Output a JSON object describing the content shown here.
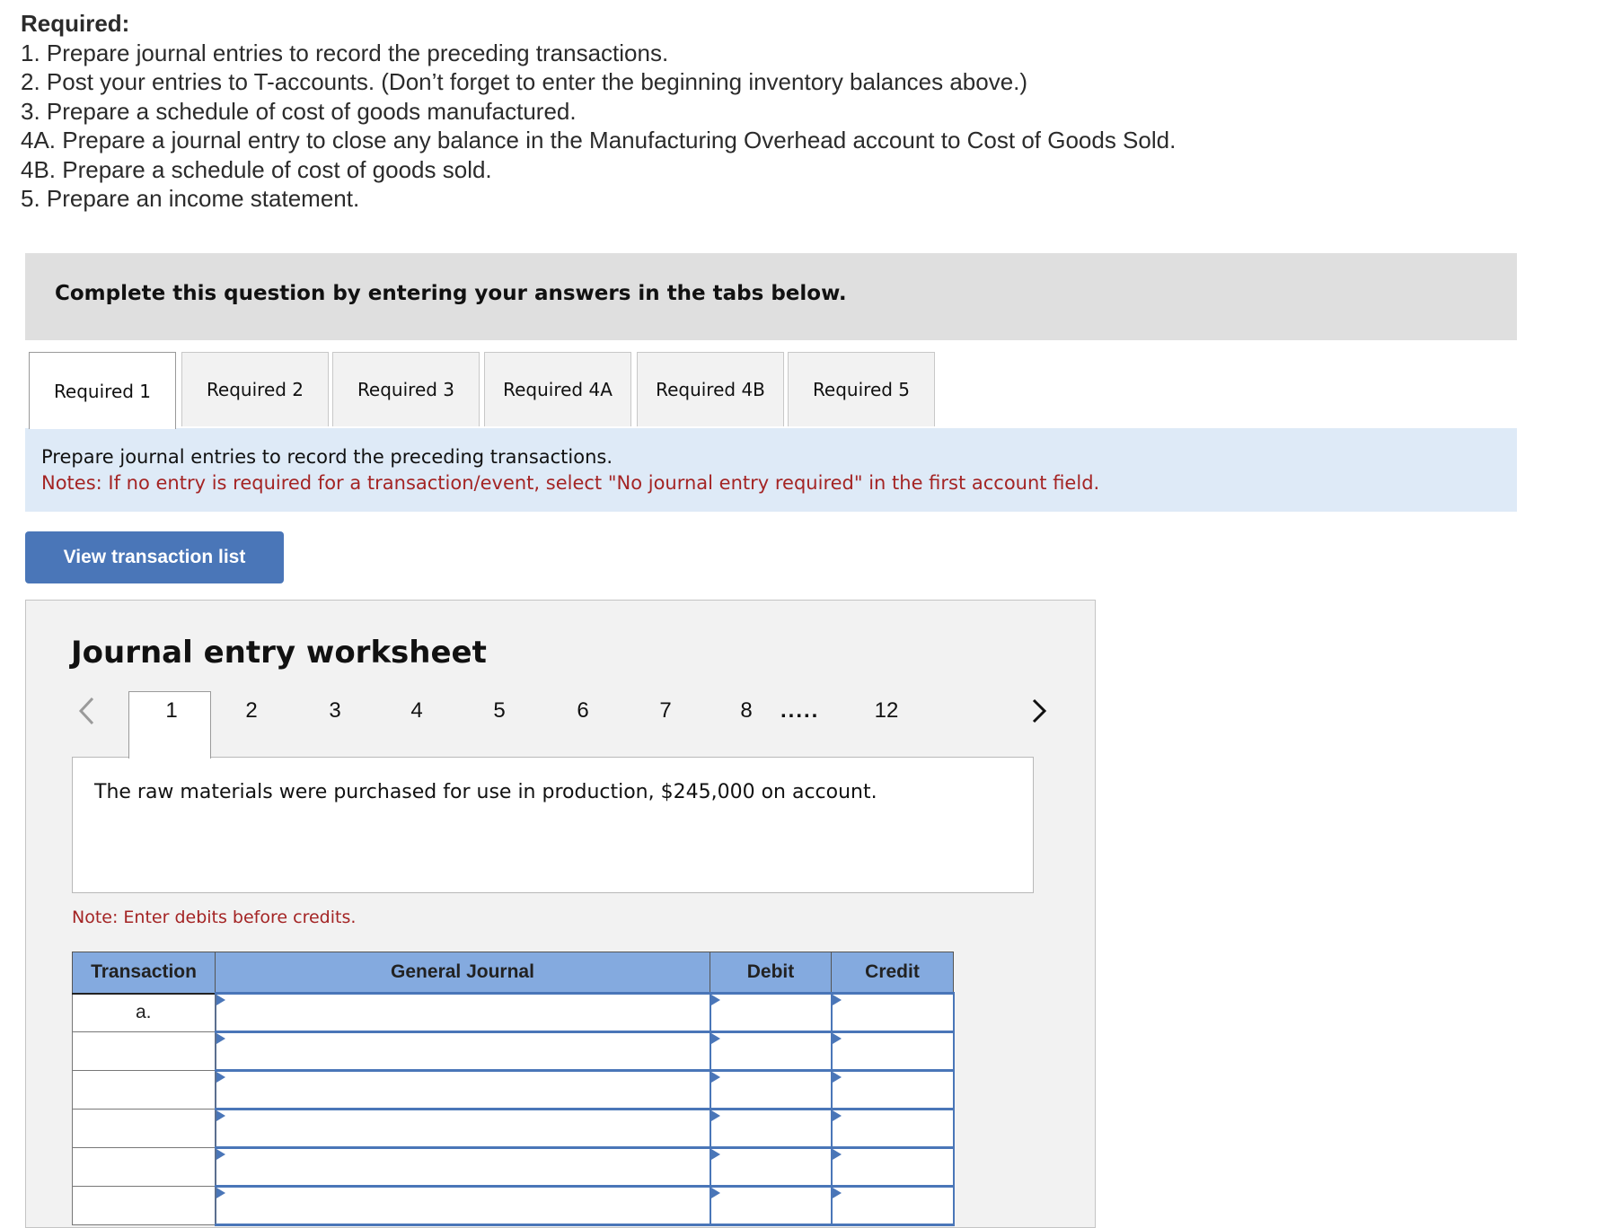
{
  "required": {
    "title": "Required:",
    "items": [
      "1. Prepare journal entries to record the preceding transactions.",
      "2. Post your entries to T-accounts. (Don’t forget to enter the beginning inventory balances above.)",
      "3. Prepare a schedule of cost of goods manufactured.",
      "4A. Prepare a journal entry to close any balance in the Manufacturing Overhead account to Cost of Goods Sold.",
      "4B. Prepare a schedule of cost of goods sold.",
      "5. Prepare an income statement."
    ]
  },
  "instructions": "Complete this question by entering your answers in the tabs below.",
  "tabs": [
    {
      "label": "Required 1",
      "active": true
    },
    {
      "label": "Required 2",
      "active": false
    },
    {
      "label": "Required 3",
      "active": false
    },
    {
      "label": "Required 4A",
      "active": false
    },
    {
      "label": "Required 4B",
      "active": false
    },
    {
      "label": "Required 5",
      "active": false
    }
  ],
  "panel": {
    "prompt": "Prepare journal entries to record the preceding transactions.",
    "note": "Notes: If no entry is required for a transaction/event, select \"No journal entry required\" in the first account field."
  },
  "view_button": "View transaction list",
  "worksheet": {
    "title": "Journal entry worksheet",
    "pages": [
      "1",
      "2",
      "3",
      "4",
      "5",
      "6",
      "7",
      "8",
      "12"
    ],
    "ellipsis": ".....",
    "active_page": "1",
    "prev_icon": "chevron-left-icon",
    "next_icon": "chevron-right-icon",
    "description": "The raw materials were purchased for use in production, $245,000 on account.",
    "debit_note": "Note: Enter debits before credits."
  },
  "table": {
    "headers": {
      "transaction": "Transaction",
      "general_journal": "General Journal",
      "debit": "Debit",
      "credit": "Credit"
    },
    "rows": [
      {
        "transaction": "a.",
        "account": "",
        "debit": "",
        "credit": ""
      },
      {
        "transaction": "",
        "account": "",
        "debit": "",
        "credit": ""
      },
      {
        "transaction": "",
        "account": "",
        "debit": "",
        "credit": ""
      },
      {
        "transaction": "",
        "account": "",
        "debit": "",
        "credit": ""
      },
      {
        "transaction": "",
        "account": "",
        "debit": "",
        "credit": ""
      },
      {
        "transaction": "",
        "account": "",
        "debit": "",
        "credit": ""
      }
    ]
  },
  "colors": {
    "accent_button": "#4a76b8",
    "note_red": "#a42424",
    "header_blue": "#84aadf",
    "panel_blue": "#deeaf7"
  }
}
